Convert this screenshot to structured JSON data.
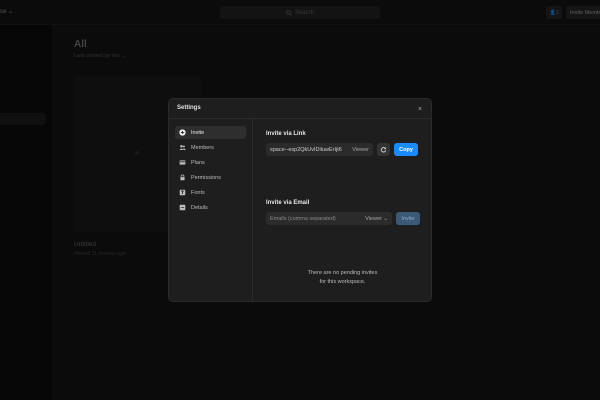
{
  "app": {
    "workspace_name": "ce ⌄",
    "search_placeholder": "Search",
    "user_count": "1",
    "invite_top_label": "Invite Members"
  },
  "main": {
    "title": "All",
    "sort_label": "Last viewed by me ⌄",
    "file": {
      "name": "Untitled",
      "meta": "Viewed 11 minutes ago"
    }
  },
  "settings_modal": {
    "title": "Settings",
    "close_glyph": "×",
    "nav": [
      {
        "label": "Invite",
        "icon": "plus-circle-icon",
        "active": true
      },
      {
        "label": "Members",
        "icon": "users-icon",
        "active": false
      },
      {
        "label": "Plans",
        "icon": "card-icon",
        "active": false
      },
      {
        "label": "Permissions",
        "icon": "lock-icon",
        "active": false
      },
      {
        "label": "Fonts",
        "icon": "font-icon",
        "active": false
      },
      {
        "label": "Details",
        "icon": "details-icon",
        "active": false
      }
    ],
    "invite_link": {
      "title": "Invite via Link",
      "link_value": "space--esp2QkUvIDiluwErIjt6",
      "role": "Viewer",
      "copy_label": "Copy"
    },
    "invite_email": {
      "title": "Invite via Email",
      "placeholder": "Emails (comma separated)",
      "role": "Viewer ⌄",
      "invite_label": "Invite"
    },
    "pending_line1": "There are no pending invites",
    "pending_line2": "for this workspace."
  },
  "colors": {
    "accent": "#1a8cff",
    "modal_bg": "#1e1e1e",
    "disabled_button": "#3a5a78"
  }
}
